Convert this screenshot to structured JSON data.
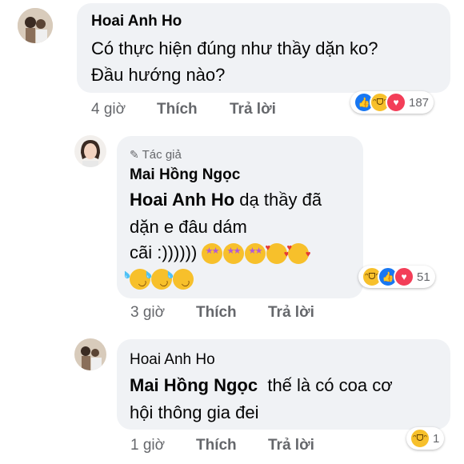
{
  "comments": [
    {
      "author": "Hoai Anh Ho",
      "text_lines": [
        "Có thực hiện đúng như thầy dặn ko?",
        "Đầu hướng nào?"
      ],
      "actions": {
        "time": "4 giờ",
        "like": "Thích",
        "reply": "Trả lời"
      },
      "reactions": {
        "icons": [
          "like-icon",
          "haha-icon",
          "love-icon"
        ],
        "count": "187"
      }
    },
    {
      "badge": "Tác giả",
      "author": "Mai Hồng Ngọc",
      "mention": "Hoai Anh Ho",
      "text_after_mention": " dạ thầy đã",
      "text_lines": [
        "dặn e đâu dám",
        "cãi :))))))"
      ],
      "emojis": [
        "star-struck-icon",
        "star-struck-icon",
        "star-struck-icon",
        "smiling-hearts-icon",
        "smiling-hearts-icon",
        "rofl-icon",
        "rofl-icon",
        "rofl-icon"
      ],
      "actions": {
        "time": "3 giờ",
        "like": "Thích",
        "reply": "Trả lời"
      },
      "reactions": {
        "icons": [
          "haha-icon",
          "like-icon",
          "love-icon"
        ],
        "count": "51"
      }
    },
    {
      "author": "Hoai Anh Ho",
      "mention": "Mai Hồng Ngọc",
      "text_after_mention": "  thế là có coa cơ",
      "text_lines": [
        "hội thông gia đei"
      ],
      "actions": {
        "time": "1 giờ",
        "like": "Thích",
        "reply": "Trả lời"
      },
      "reactions": {
        "icons": [
          "haha-icon"
        ],
        "count": "1"
      }
    }
  ],
  "colors": {
    "bubble": "#f0f2f5",
    "secondary_text": "#65676b",
    "like": "#1877f2",
    "love": "#f33e58",
    "haha": "#f7c02b"
  }
}
